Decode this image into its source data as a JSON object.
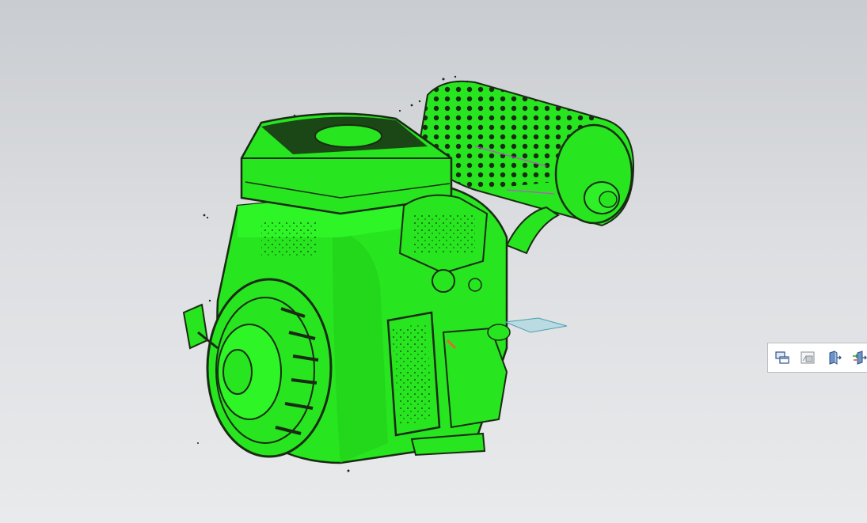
{
  "viewport": {
    "background_top": "#c9ccd0",
    "background_bottom": "#e9eaec"
  },
  "model": {
    "description_icon": "engine-point-cloud-model",
    "primary_color": "#27e51f",
    "edge_color": "#1a2a14",
    "accent_color": "#c04fd0"
  },
  "selection_plane": {
    "color": "#9cd6e0"
  },
  "mini_toolbar": {
    "buttons": [
      {
        "icon": "fit-view-icon"
      },
      {
        "icon": "render-style-icon"
      },
      {
        "icon": "section-view-icon"
      },
      {
        "icon": "orient-view-icon"
      }
    ]
  }
}
